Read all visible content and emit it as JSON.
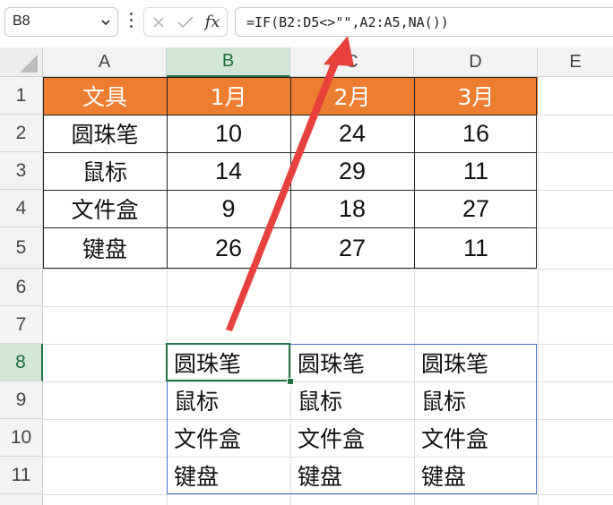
{
  "name_box": {
    "value": "B8"
  },
  "formula_bar": {
    "fx_label": "fx",
    "formula": "=IF(B2:D5<>\"\",A2:A5,NA())"
  },
  "columns": [
    "A",
    "B",
    "C",
    "D",
    "E"
  ],
  "rows": [
    "1",
    "2",
    "3",
    "4",
    "5",
    "6",
    "7",
    "8",
    "9",
    "10",
    "11"
  ],
  "selected_cell": "B8",
  "table": {
    "header": [
      "文具",
      "1月",
      "2月",
      "3月"
    ],
    "rows": [
      [
        "圆珠笔",
        "10",
        "24",
        "16"
      ],
      [
        "鼠标",
        "14",
        "29",
        "11"
      ],
      [
        "文件盒",
        "9",
        "18",
        "27"
      ],
      [
        "键盘",
        "26",
        "27",
        "11"
      ]
    ]
  },
  "spill_result": [
    [
      "圆珠笔",
      "圆珠笔",
      "圆珠笔"
    ],
    [
      "鼠标",
      "鼠标",
      "鼠标"
    ],
    [
      "文件盒",
      "文件盒",
      "文件盒"
    ],
    [
      "键盘",
      "键盘",
      "键盘"
    ]
  ],
  "colors": {
    "header_fill": "#ed7d31",
    "selection": "#217346",
    "spill_border": "#4472c4",
    "annotation_arrow": "#e8403a"
  }
}
